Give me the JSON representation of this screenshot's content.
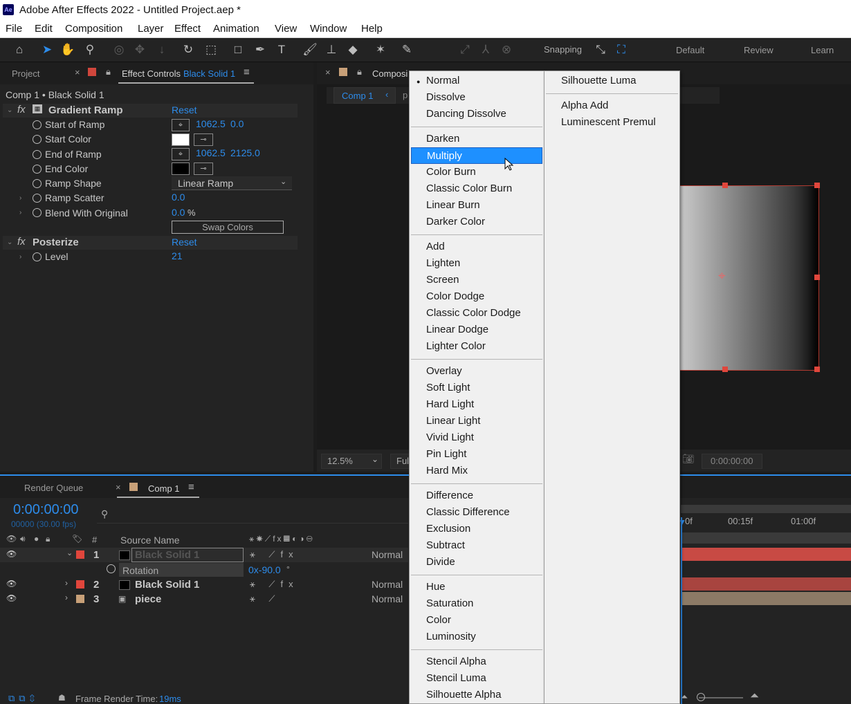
{
  "window": {
    "title": "Adobe After Effects 2022 - Untitled Project.aep *",
    "logo": "Ae"
  },
  "menu": [
    "File",
    "Edit",
    "Composition",
    "Layer",
    "Effect",
    "Animation",
    "View",
    "Window",
    "Help"
  ],
  "toolbar": {
    "snapping_label": "Snapping",
    "workspaces": [
      "Default",
      "Review",
      "Learn"
    ]
  },
  "left_panel": {
    "tab_project": "Project",
    "tab_effect_controls": "Effect Controls",
    "effect_controls_layer": "Black Solid 1",
    "breadcrumb": "Comp 1 • Black Solid 1",
    "effects": {
      "gradient_ramp": {
        "name": "Gradient Ramp",
        "reset": "Reset",
        "start_of_ramp_label": "Start of Ramp",
        "start_of_ramp_x": "1062.5",
        "start_of_ramp_y": "0.0",
        "start_color_label": "Start Color",
        "end_of_ramp_label": "End of Ramp",
        "end_of_ramp_x": "1062.5",
        "end_of_ramp_y": "2125.0",
        "end_color_label": "End Color",
        "ramp_shape_label": "Ramp Shape",
        "ramp_shape_value": "Linear Ramp",
        "ramp_scatter_label": "Ramp Scatter",
        "ramp_scatter_value": "0.0",
        "blend_label": "Blend With Original",
        "blend_value": "0.0",
        "blend_unit": "%",
        "swap_colors": "Swap Colors"
      },
      "posterize": {
        "name": "Posterize",
        "reset": "Reset",
        "level_label": "Level",
        "level_value": "21"
      }
    }
  },
  "comp_panel": {
    "tab_label": "Composi",
    "comp_tab": "Comp 1",
    "zoom": "12.5%",
    "resolution": "Ful",
    "timecode": "0:00:00:00"
  },
  "timeline": {
    "tab_render_queue": "Render Queue",
    "tab_comp": "Comp 1",
    "current_time": "0:00:00:00",
    "frame_info": "00000 (30.00 fps)",
    "col_number": "#",
    "col_source_name": "Source Name",
    "ruler": [
      "0f",
      "00:15f",
      "01:00f"
    ],
    "layers": [
      {
        "num": "1",
        "name": "Black Solid 1",
        "mode": "Normal"
      },
      {
        "num": "2",
        "name": "Black Solid 1",
        "mode": "Normal"
      },
      {
        "num": "3",
        "name": "piece",
        "mode": "Normal"
      }
    ],
    "rotation_label": "Rotation",
    "rotation_value": "0x-90.0",
    "rotation_unit": "°",
    "footer_label": "Frame Render Time:",
    "footer_value": "19ms"
  },
  "blend_menu": {
    "col1": {
      "group1": [
        "Normal",
        "Dissolve",
        "Dancing Dissolve"
      ],
      "group2": [
        "Darken",
        "Multiply",
        "Color Burn",
        "Classic Color Burn",
        "Linear Burn",
        "Darker Color"
      ],
      "group3": [
        "Add",
        "Lighten",
        "Screen",
        "Color Dodge",
        "Classic Color Dodge",
        "Linear Dodge",
        "Lighter Color"
      ],
      "group4": [
        "Overlay",
        "Soft Light",
        "Hard Light",
        "Linear Light",
        "Vivid Light",
        "Pin Light",
        "Hard Mix"
      ],
      "group5": [
        "Difference",
        "Classic Difference",
        "Exclusion",
        "Subtract",
        "Divide"
      ],
      "group6": [
        "Hue",
        "Saturation",
        "Color",
        "Luminosity"
      ],
      "group7": [
        "Stencil Alpha",
        "Stencil Luma",
        "Silhouette Alpha"
      ]
    },
    "col2": {
      "group1": [
        "Silhouette Luma"
      ],
      "group2": [
        "Alpha Add",
        "Luminescent Premul"
      ]
    },
    "checked": "Normal",
    "highlighted": "Multiply"
  },
  "colors": {
    "accent": "#2d8ceb",
    "highlight": "#1e90ff",
    "label_red": "#e0463c",
    "label_tan": "#c8a078"
  }
}
